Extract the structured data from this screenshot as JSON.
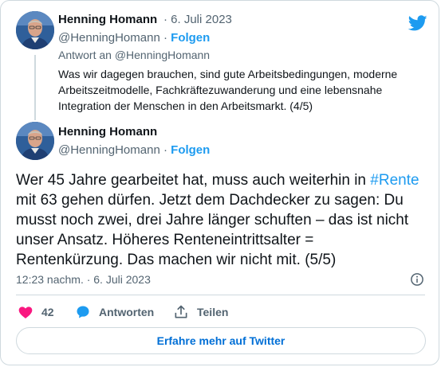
{
  "reply_tweet": {
    "author_name": "Henning Homann",
    "date": "· 6. Juli 2023",
    "handle": "@HenningHomann",
    "separator": " · ",
    "follow_label": "Folgen",
    "reply_to": "Antwort an @HenningHomann",
    "text": "Was wir dagegen brauchen, sind gute Arbeitsbedingungen, moderne Arbeitszeitmodelle, Fachkräftezuwanderung und eine lebensnahe Integration der Menschen in den Arbeitsmarkt. (4/5)"
  },
  "main_tweet": {
    "author_name": "Henning Homann",
    "handle": "@HenningHomann",
    "separator": " · ",
    "follow_label": "Folgen",
    "text_before": "Wer 45 Jahre gearbeitet hat, muss auch weiterhin in ",
    "hashtag": "#Rente",
    "text_after": " mit 63 gehen dürfen. Jetzt dem Dachdecker zu sagen: Du musst noch zwei, drei Jahre länger schuften – das ist nicht unser Ansatz. Höheres Renteneintrittsalter = Rentenkürzung. Das machen wir nicht mit. (5/5)",
    "timestamp": "12:23 nachm. · 6. Juli 2023"
  },
  "actions": {
    "like_count": "42",
    "reply_label": "Antworten",
    "share_label": "Teilen"
  },
  "cta_label": "Erfahre mehr auf Twitter",
  "colors": {
    "accent": "#1d9bf0",
    "like": "#f91880",
    "muted": "#536471",
    "border": "#cfd9de"
  },
  "icons": [
    "twitter-bird-icon",
    "info-icon",
    "heart-icon",
    "reply-bubble-icon",
    "share-icon"
  ]
}
